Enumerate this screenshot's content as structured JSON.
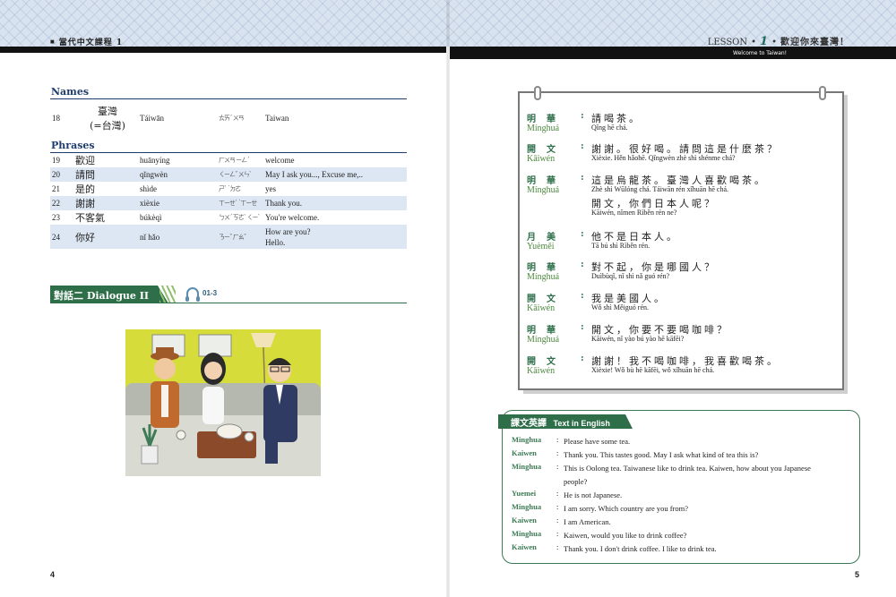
{
  "header": {
    "book_title": "當代中文課程 1",
    "lesson_label": "LESSON",
    "lesson_number": "1",
    "lesson_title_zh": "歡迎你來臺灣！",
    "lesson_title_en": "Welcome to Taiwan!"
  },
  "names": {
    "label": "Names",
    "rows": [
      {
        "num": "18",
        "zh": "臺灣",
        "zh_alt": "(=台灣)",
        "pinyin": "Táiwān",
        "zhuyin": "ㄊㄞˊ ㄨㄢ",
        "en": "Taiwan"
      }
    ]
  },
  "phrases": {
    "label": "Phrases",
    "rows": [
      {
        "num": "19",
        "zh": "歡迎",
        "pinyin": "huānyíng",
        "zhuyin": "ㄏㄨㄢ ㄧㄥˊ",
        "en": "welcome"
      },
      {
        "num": "20",
        "zh": "請問",
        "pinyin": "qǐngwèn",
        "zhuyin": "ㄑㄧㄥˇ ㄨㄣˋ",
        "en": "May I ask you..., Excuse me,.."
      },
      {
        "num": "21",
        "zh": "是的",
        "pinyin": "shìde",
        "zhuyin": "ㄕˋ ˙ㄉㄜ",
        "en": "yes"
      },
      {
        "num": "22",
        "zh": "謝謝",
        "pinyin": "xièxie",
        "zhuyin": "ㄒㄧㄝˋ ˙ㄒㄧㄝ",
        "en": "Thank you."
      },
      {
        "num": "23",
        "zh": "不客氣",
        "pinyin": "búkèqì",
        "zhuyin": "ㄅㄨˊ ㄎㄜˋ ㄑㄧˋ",
        "en": "You're welcome."
      },
      {
        "num": "24",
        "zh": "你好",
        "pinyin": "nǐ hǎo",
        "zhuyin": "ㄋㄧˇ ㄏㄠˇ",
        "en": "How are you?",
        "en2": "Hello."
      }
    ]
  },
  "dialogue": {
    "title_zh": "對話二",
    "title_en": "Dialogue II",
    "audio_track": "01-3",
    "lines": [
      {
        "spk_zh": "明華",
        "spk_py": "Mínghuá",
        "zh": "請喝茶。",
        "py": "Qǐng hē chá."
      },
      {
        "spk_zh": "開文",
        "spk_py": "Kāiwén",
        "zh": "謝謝。很好喝。請問這是什麼茶？",
        "py": "Xièxie. Hěn hǎohē. Qǐngwèn zhè shì shénme chá?"
      },
      {
        "spk_zh": "明華",
        "spk_py": "Mínghuá",
        "zh": "這是烏龍茶。臺灣人喜歡喝茶。",
        "py": "Zhè shì Wūlóng chá. Táiwān rén xǐhuān hē chá.",
        "zh2": "開文，你們日本人呢？",
        "py2": "Kāiwén, nǐmen Rìběn rén ne?"
      },
      {
        "spk_zh": "月美",
        "spk_py": "Yuèměi",
        "zh": "他不是日本人。",
        "py": "Tā bú shì Rìběn rén."
      },
      {
        "spk_zh": "明華",
        "spk_py": "Mínghuá",
        "zh": "對不起，你是哪國人？",
        "py": "Duìbùqǐ, nǐ shì nǎ guó rén?"
      },
      {
        "spk_zh": "開文",
        "spk_py": "Kāiwén",
        "zh": "我是美國人。",
        "py": "Wǒ shì Měiguó rén."
      },
      {
        "spk_zh": "明華",
        "spk_py": "Mínghuá",
        "zh": "開文，你要不要喝咖啡？",
        "py": "Kāiwén, nǐ yào bú yào hē kāfēi?"
      },
      {
        "spk_zh": "開文",
        "spk_py": "Kāiwén",
        "zh": "謝謝！我不喝咖啡，我喜歡喝茶。",
        "py": "Xièxie! Wǒ bù hē kāfēi, wǒ xǐhuān hē chá."
      }
    ]
  },
  "english": {
    "title_zh": "課文英譯",
    "title_en": "Text in English",
    "lines": [
      {
        "name": "Minghua",
        "text": "Please have some tea."
      },
      {
        "name": "Kaiwen",
        "text": "Thank you. This tastes good. May I ask what kind of tea this is?"
      },
      {
        "name": "Minghua",
        "text": "This is Oolong tea. Taiwanese like to drink tea. Kaiwen, how about you Japanese people?"
      },
      {
        "name": "Yuemei",
        "text": "He is not Japanese."
      },
      {
        "name": "Minghua",
        "text": "I am sorry. Which country are you from?"
      },
      {
        "name": "Kaiwen",
        "text": "I am American."
      },
      {
        "name": "Minghua",
        "text": "Kaiwen, would you like to drink coffee?"
      },
      {
        "name": "Kaiwen",
        "text": "Thank you. I don't drink coffee. I like to drink tea."
      }
    ]
  },
  "pages": {
    "left": "4",
    "right": "5"
  }
}
